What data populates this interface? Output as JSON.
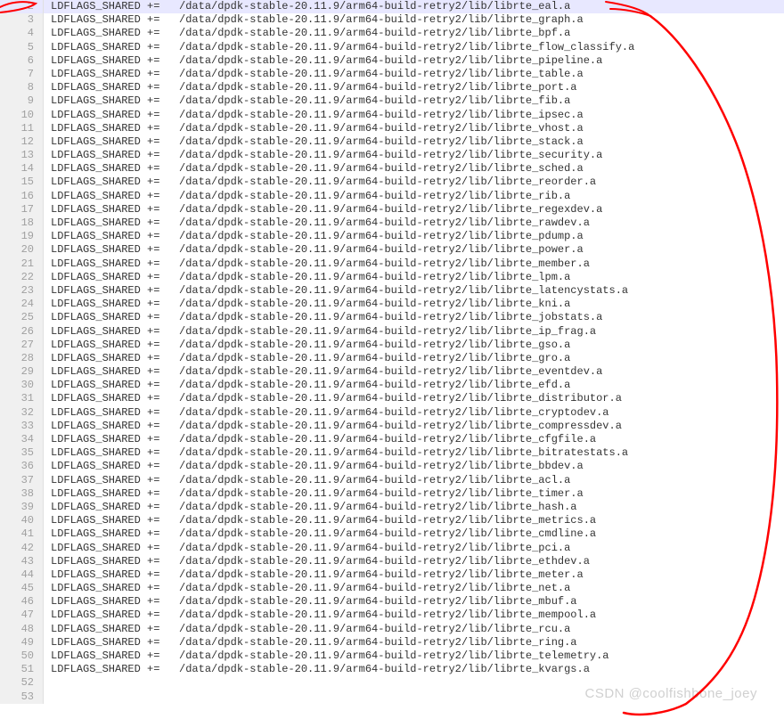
{
  "path_prefix": "/data/dpdk-stable-20.11.9/arm64-build-retry2/lib/",
  "var_expr": "LDFLAGS_SHARED +=   ",
  "highlight_line": 2,
  "cursor_after": "/data/dpdk-stable-20.11.9/arm64-build-retry2/lib/librte_eal.a",
  "lines": [
    {
      "n": 2,
      "lib": "librte_eal.a"
    },
    {
      "n": 3,
      "lib": "librte_graph.a"
    },
    {
      "n": 4,
      "lib": "librte_bpf.a"
    },
    {
      "n": 5,
      "lib": "librte_flow_classify.a"
    },
    {
      "n": 6,
      "lib": "librte_pipeline.a"
    },
    {
      "n": 7,
      "lib": "librte_table.a"
    },
    {
      "n": 8,
      "lib": "librte_port.a"
    },
    {
      "n": 9,
      "lib": "librte_fib.a"
    },
    {
      "n": 10,
      "lib": "librte_ipsec.a"
    },
    {
      "n": 11,
      "lib": "librte_vhost.a"
    },
    {
      "n": 12,
      "lib": "librte_stack.a"
    },
    {
      "n": 13,
      "lib": "librte_security.a"
    },
    {
      "n": 14,
      "lib": "librte_sched.a"
    },
    {
      "n": 15,
      "lib": "librte_reorder.a"
    },
    {
      "n": 16,
      "lib": "librte_rib.a"
    },
    {
      "n": 17,
      "lib": "librte_regexdev.a"
    },
    {
      "n": 18,
      "lib": "librte_rawdev.a"
    },
    {
      "n": 19,
      "lib": "librte_pdump.a"
    },
    {
      "n": 20,
      "lib": "librte_power.a"
    },
    {
      "n": 21,
      "lib": "librte_member.a"
    },
    {
      "n": 22,
      "lib": "librte_lpm.a"
    },
    {
      "n": 23,
      "lib": "librte_latencystats.a"
    },
    {
      "n": 24,
      "lib": "librte_kni.a"
    },
    {
      "n": 25,
      "lib": "librte_jobstats.a"
    },
    {
      "n": 26,
      "lib": "librte_ip_frag.a"
    },
    {
      "n": 27,
      "lib": "librte_gso.a"
    },
    {
      "n": 28,
      "lib": "librte_gro.a"
    },
    {
      "n": 29,
      "lib": "librte_eventdev.a"
    },
    {
      "n": 30,
      "lib": "librte_efd.a"
    },
    {
      "n": 31,
      "lib": "librte_distributor.a"
    },
    {
      "n": 32,
      "lib": "librte_cryptodev.a"
    },
    {
      "n": 33,
      "lib": "librte_compressdev.a"
    },
    {
      "n": 34,
      "lib": "librte_cfgfile.a"
    },
    {
      "n": 35,
      "lib": "librte_bitratestats.a"
    },
    {
      "n": 36,
      "lib": "librte_bbdev.a"
    },
    {
      "n": 37,
      "lib": "librte_acl.a"
    },
    {
      "n": 38,
      "lib": "librte_timer.a"
    },
    {
      "n": 39,
      "lib": "librte_hash.a"
    },
    {
      "n": 40,
      "lib": "librte_metrics.a"
    },
    {
      "n": 41,
      "lib": "librte_cmdline.a"
    },
    {
      "n": 42,
      "lib": "librte_pci.a"
    },
    {
      "n": 43,
      "lib": "librte_ethdev.a"
    },
    {
      "n": 44,
      "lib": "librte_meter.a"
    },
    {
      "n": 45,
      "lib": "librte_net.a"
    },
    {
      "n": 46,
      "lib": "librte_mbuf.a"
    },
    {
      "n": 47,
      "lib": "librte_mempool.a"
    },
    {
      "n": 48,
      "lib": "librte_rcu.a"
    },
    {
      "n": 49,
      "lib": "librte_ring.a"
    },
    {
      "n": 50,
      "lib": "librte_telemetry.a"
    },
    {
      "n": 51,
      "lib": "librte_kvargs.a"
    },
    {
      "n": 52,
      "lib": ""
    },
    {
      "n": 53,
      "lib": ""
    }
  ],
  "watermark": "CSDN @coolfishbone_joey",
  "annotation": {
    "color": "#ff0000",
    "stroke_width": 2
  }
}
